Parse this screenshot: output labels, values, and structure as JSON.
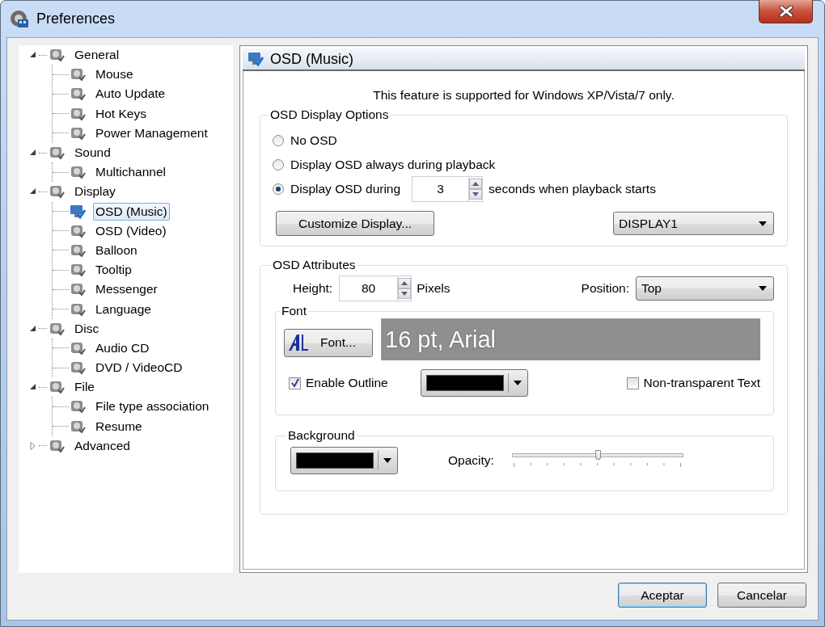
{
  "window": {
    "title": "Preferences"
  },
  "tree": [
    {
      "label": "General",
      "expanded": true,
      "selected": false,
      "children": [
        {
          "label": "Mouse",
          "selected": false
        },
        {
          "label": "Auto Update",
          "selected": false
        },
        {
          "label": "Hot Keys",
          "selected": false
        },
        {
          "label": "Power Management",
          "selected": false
        }
      ]
    },
    {
      "label": "Sound",
      "expanded": true,
      "selected": false,
      "children": [
        {
          "label": "Multichannel",
          "selected": false
        }
      ]
    },
    {
      "label": "Display",
      "expanded": true,
      "selected": false,
      "children": [
        {
          "label": "OSD (Music)",
          "selected": true
        },
        {
          "label": "OSD (Video)",
          "selected": false
        },
        {
          "label": "Balloon",
          "selected": false
        },
        {
          "label": "Tooltip",
          "selected": false
        },
        {
          "label": "Messenger",
          "selected": false
        },
        {
          "label": "Language",
          "selected": false
        }
      ]
    },
    {
      "label": "Disc",
      "expanded": true,
      "selected": false,
      "children": [
        {
          "label": "Audio CD",
          "selected": false
        },
        {
          "label": "DVD / VideoCD",
          "selected": false
        }
      ]
    },
    {
      "label": "File",
      "expanded": true,
      "selected": false,
      "children": [
        {
          "label": "File type association",
          "selected": false
        },
        {
          "label": "Resume",
          "selected": false
        }
      ]
    },
    {
      "label": "Advanced",
      "expanded": false,
      "selected": false
    }
  ],
  "panel": {
    "title": "OSD (Music)",
    "notice": "This feature is supported for Windows XP/Vista/7 only.",
    "display_options": {
      "title": "OSD Display Options",
      "options": [
        {
          "kind": "plain",
          "label": "No OSD",
          "selected": false
        },
        {
          "kind": "plain",
          "label": "Display OSD always during playback",
          "selected": false
        },
        {
          "kind": "timed",
          "label": "Display OSD during",
          "selected": true,
          "seconds": "3",
          "suffix": "seconds when playback starts"
        }
      ],
      "customize_button": "Customize Display...",
      "display_select": "DISPLAY1"
    },
    "attributes": {
      "title": "OSD Attributes",
      "height_label": "Height:",
      "height_value": "80",
      "height_unit": "Pixels",
      "position_label": "Position:",
      "position_value": "Top",
      "font": {
        "title": "Font",
        "button": "Font...",
        "preview": "16 pt, Arial",
        "enable_outline": {
          "label": "Enable Outline",
          "checked": true
        },
        "outline": {
          "color": "#000000"
        },
        "non_transparent": {
          "label": "Non-transparent Text",
          "checked": false
        }
      },
      "background": {
        "title": "Background",
        "color": "#000000",
        "opacity_label": "Opacity:",
        "opacity": {
          "level": 0.5
        }
      }
    }
  },
  "buttons": [
    {
      "label": "Aceptar",
      "default": true
    },
    {
      "label": "Cancelar",
      "default": false
    }
  ]
}
